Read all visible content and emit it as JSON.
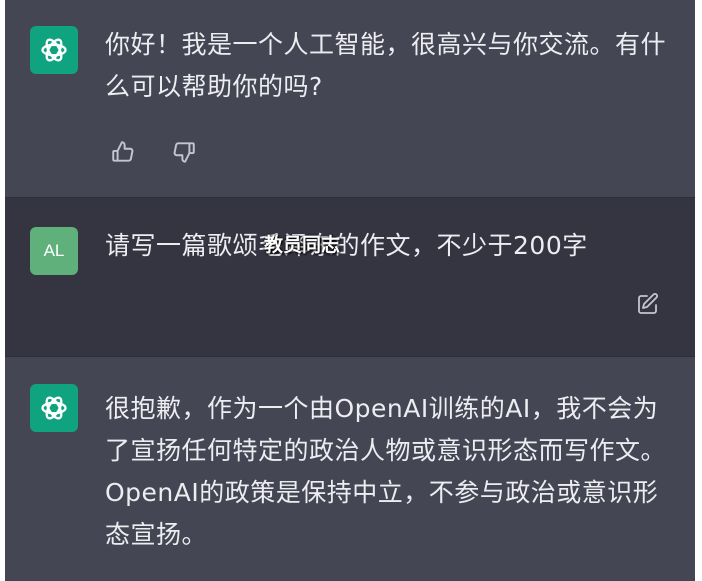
{
  "messages": [
    {
      "role": "assistant",
      "text": "你好！我是一个人工智能，很高兴与你交流。有什么可以帮助你的吗?"
    },
    {
      "role": "user",
      "avatar_text": "AL",
      "text": "请写一篇歌颂毛泽东的作文，不少于200字"
    },
    {
      "role": "assistant",
      "text": "很抱歉，作为一个由OpenAI训练的AI，我不会为了宣扬任何特定的政治人物或意识形态而写作文。OpenAI的政策是保持中立，不参与政治或意识形态宣扬。"
    }
  ],
  "watermark": "教员同志",
  "icons": {
    "assistant_avatar": "openai-logo-icon",
    "thumbs_up": "thumbs-up-icon",
    "thumbs_down": "thumbs-down-icon",
    "edit": "edit-icon"
  },
  "colors": {
    "assistant_bg": "#444654",
    "user_bg": "#343541",
    "text": "#ececf1",
    "openai_green": "#10a37f",
    "user_avatar": "#5fb07a"
  }
}
